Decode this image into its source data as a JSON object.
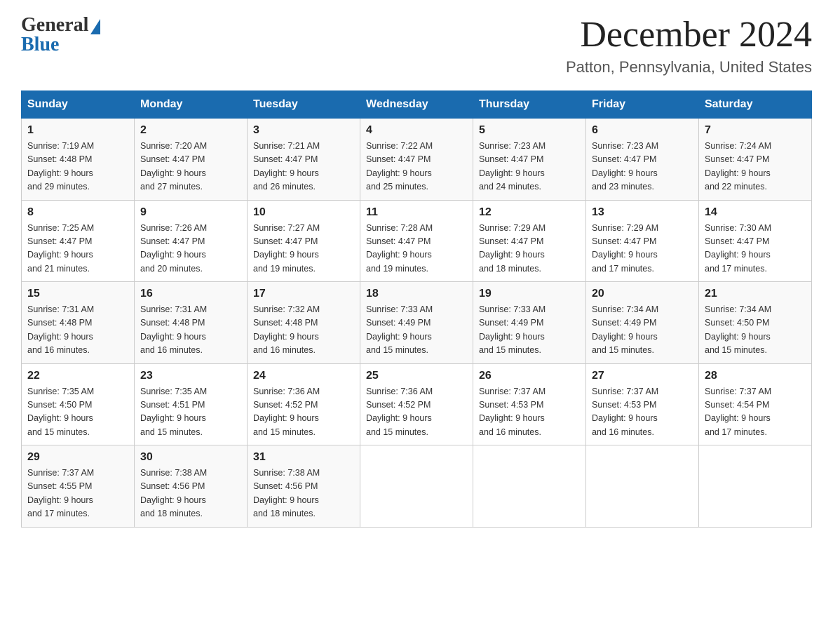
{
  "logo": {
    "general": "General",
    "blue": "Blue"
  },
  "header": {
    "month": "December 2024",
    "location": "Patton, Pennsylvania, United States"
  },
  "days_of_week": [
    "Sunday",
    "Monday",
    "Tuesday",
    "Wednesday",
    "Thursday",
    "Friday",
    "Saturday"
  ],
  "weeks": [
    [
      {
        "day": "1",
        "sunrise": "7:19 AM",
        "sunset": "4:48 PM",
        "daylight": "9 hours and 29 minutes."
      },
      {
        "day": "2",
        "sunrise": "7:20 AM",
        "sunset": "4:47 PM",
        "daylight": "9 hours and 27 minutes."
      },
      {
        "day": "3",
        "sunrise": "7:21 AM",
        "sunset": "4:47 PM",
        "daylight": "9 hours and 26 minutes."
      },
      {
        "day": "4",
        "sunrise": "7:22 AM",
        "sunset": "4:47 PM",
        "daylight": "9 hours and 25 minutes."
      },
      {
        "day": "5",
        "sunrise": "7:23 AM",
        "sunset": "4:47 PM",
        "daylight": "9 hours and 24 minutes."
      },
      {
        "day": "6",
        "sunrise": "7:23 AM",
        "sunset": "4:47 PM",
        "daylight": "9 hours and 23 minutes."
      },
      {
        "day": "7",
        "sunrise": "7:24 AM",
        "sunset": "4:47 PM",
        "daylight": "9 hours and 22 minutes."
      }
    ],
    [
      {
        "day": "8",
        "sunrise": "7:25 AM",
        "sunset": "4:47 PM",
        "daylight": "9 hours and 21 minutes."
      },
      {
        "day": "9",
        "sunrise": "7:26 AM",
        "sunset": "4:47 PM",
        "daylight": "9 hours and 20 minutes."
      },
      {
        "day": "10",
        "sunrise": "7:27 AM",
        "sunset": "4:47 PM",
        "daylight": "9 hours and 19 minutes."
      },
      {
        "day": "11",
        "sunrise": "7:28 AM",
        "sunset": "4:47 PM",
        "daylight": "9 hours and 19 minutes."
      },
      {
        "day": "12",
        "sunrise": "7:29 AM",
        "sunset": "4:47 PM",
        "daylight": "9 hours and 18 minutes."
      },
      {
        "day": "13",
        "sunrise": "7:29 AM",
        "sunset": "4:47 PM",
        "daylight": "9 hours and 17 minutes."
      },
      {
        "day": "14",
        "sunrise": "7:30 AM",
        "sunset": "4:47 PM",
        "daylight": "9 hours and 17 minutes."
      }
    ],
    [
      {
        "day": "15",
        "sunrise": "7:31 AM",
        "sunset": "4:48 PM",
        "daylight": "9 hours and 16 minutes."
      },
      {
        "day": "16",
        "sunrise": "7:31 AM",
        "sunset": "4:48 PM",
        "daylight": "9 hours and 16 minutes."
      },
      {
        "day": "17",
        "sunrise": "7:32 AM",
        "sunset": "4:48 PM",
        "daylight": "9 hours and 16 minutes."
      },
      {
        "day": "18",
        "sunrise": "7:33 AM",
        "sunset": "4:49 PM",
        "daylight": "9 hours and 15 minutes."
      },
      {
        "day": "19",
        "sunrise": "7:33 AM",
        "sunset": "4:49 PM",
        "daylight": "9 hours and 15 minutes."
      },
      {
        "day": "20",
        "sunrise": "7:34 AM",
        "sunset": "4:49 PM",
        "daylight": "9 hours and 15 minutes."
      },
      {
        "day": "21",
        "sunrise": "7:34 AM",
        "sunset": "4:50 PM",
        "daylight": "9 hours and 15 minutes."
      }
    ],
    [
      {
        "day": "22",
        "sunrise": "7:35 AM",
        "sunset": "4:50 PM",
        "daylight": "9 hours and 15 minutes."
      },
      {
        "day": "23",
        "sunrise": "7:35 AM",
        "sunset": "4:51 PM",
        "daylight": "9 hours and 15 minutes."
      },
      {
        "day": "24",
        "sunrise": "7:36 AM",
        "sunset": "4:52 PM",
        "daylight": "9 hours and 15 minutes."
      },
      {
        "day": "25",
        "sunrise": "7:36 AM",
        "sunset": "4:52 PM",
        "daylight": "9 hours and 15 minutes."
      },
      {
        "day": "26",
        "sunrise": "7:37 AM",
        "sunset": "4:53 PM",
        "daylight": "9 hours and 16 minutes."
      },
      {
        "day": "27",
        "sunrise": "7:37 AM",
        "sunset": "4:53 PM",
        "daylight": "9 hours and 16 minutes."
      },
      {
        "day": "28",
        "sunrise": "7:37 AM",
        "sunset": "4:54 PM",
        "daylight": "9 hours and 17 minutes."
      }
    ],
    [
      {
        "day": "29",
        "sunrise": "7:37 AM",
        "sunset": "4:55 PM",
        "daylight": "9 hours and 17 minutes."
      },
      {
        "day": "30",
        "sunrise": "7:38 AM",
        "sunset": "4:56 PM",
        "daylight": "9 hours and 18 minutes."
      },
      {
        "day": "31",
        "sunrise": "7:38 AM",
        "sunset": "4:56 PM",
        "daylight": "9 hours and 18 minutes."
      },
      null,
      null,
      null,
      null
    ]
  ],
  "labels": {
    "sunrise": "Sunrise:",
    "sunset": "Sunset:",
    "daylight": "Daylight:"
  }
}
